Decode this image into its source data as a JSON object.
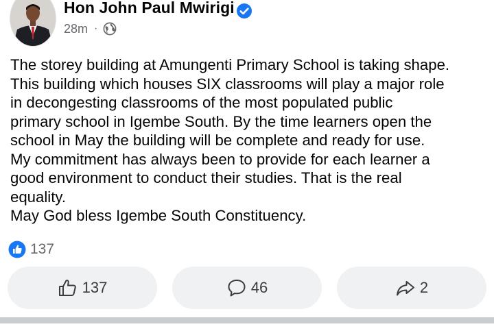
{
  "post": {
    "author": "Hon John Paul Mwirigi",
    "time": "28m",
    "separator": "·",
    "audience_icon": "globe-icon",
    "verified_icon": "verified-badge-icon",
    "text_lines": [
      "The storey building at Amungenti Primary School is taking shape.",
      "This building which houses SIX classrooms will play a major role",
      "in decongesting classrooms of the most populated public",
      "primary school in Igembe South. By the time learners open the",
      "school in May the building will be complete and ready for use.",
      "My commitment has always been to provide for each learner a",
      "good environment to conduct their studies. That is the real",
      "equality.",
      "May God bless Igembe South Constituency."
    ]
  },
  "reactions": {
    "icon": "like-reaction-icon",
    "count": "137"
  },
  "actions": {
    "like": {
      "icon": "thumbs-up-icon",
      "count": "137"
    },
    "comment": {
      "icon": "comment-icon",
      "count": "46"
    },
    "share": {
      "icon": "share-icon",
      "count": "2"
    }
  },
  "colors": {
    "accent": "#1877f2",
    "text": "#050505",
    "secondary_text": "#65676b",
    "button_bg": "#eff1f3",
    "divider": "#c9ccd1"
  }
}
